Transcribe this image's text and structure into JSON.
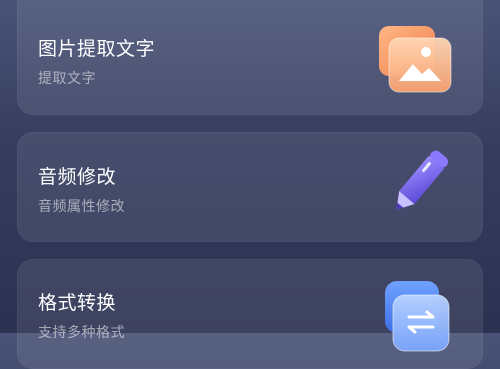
{
  "cards": [
    {
      "title": "图片提取文字",
      "subtitle": "提取文字",
      "icon": "image-icon"
    },
    {
      "title": "音频修改",
      "subtitle": "音频属性修改",
      "icon": "pen-icon"
    },
    {
      "title": "格式转换",
      "subtitle": "支持多种格式",
      "icon": "convert-icon"
    }
  ],
  "colors": {
    "background_top": "#4a5377",
    "background_bottom": "#2b3151",
    "image_icon_orange": "#f7a06a",
    "pen_icon_purple": "#7f6ef2",
    "convert_icon_blue": "#5d8ef7"
  }
}
